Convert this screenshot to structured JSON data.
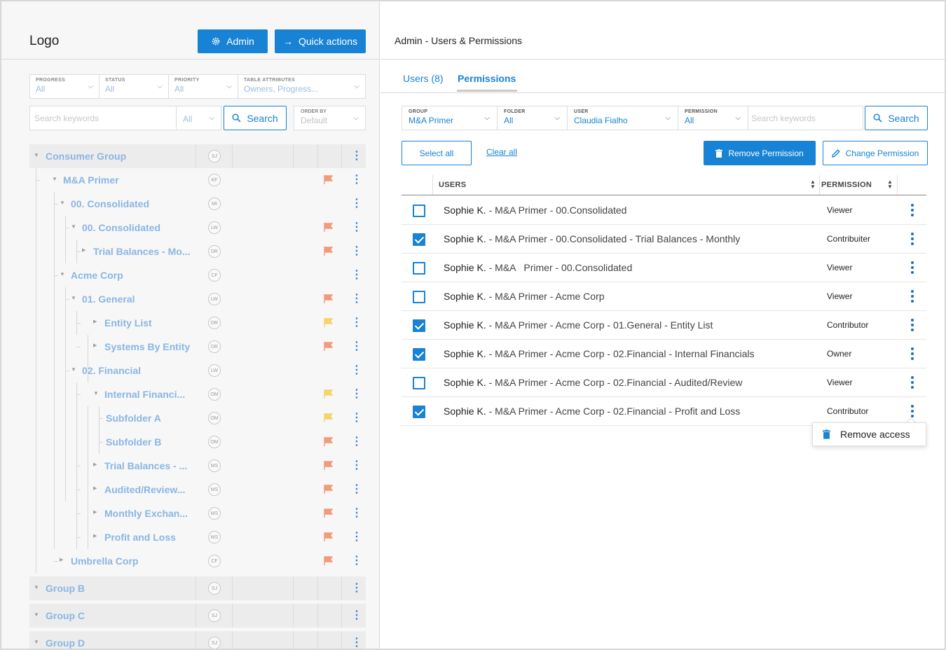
{
  "left": {
    "logo": "Logo",
    "admin_label": "Admin",
    "quick_actions_label": "Quick actions",
    "filters": [
      {
        "label": "PROGRESS",
        "value": "All"
      },
      {
        "label": "STATUS",
        "value": "All"
      },
      {
        "label": "PRIORITY",
        "value": "All"
      },
      {
        "label": "TABLE ATTRIBUTES",
        "value": "Owners, Progress..."
      }
    ],
    "search_placeholder": "Search keywords",
    "scope_value": "All",
    "search_label": "Search",
    "order_by": {
      "label": "ORDER BY",
      "value": "Default"
    },
    "tree": [
      {
        "name": "Consumer Group",
        "avatar": "SJ",
        "group": true,
        "flag": ""
      },
      {
        "name": "M&A Primer",
        "avatar": "KF",
        "flag": "#f19a7c"
      },
      {
        "name": "00. Consolidated",
        "avatar": "MI",
        "flag": ""
      },
      {
        "name": "00. Consolidated",
        "avatar": "LW",
        "flag": "#f19a7c"
      },
      {
        "name": "Trial Balances - Mo...",
        "avatar": "DR",
        "flag": "#f19a7c"
      },
      {
        "name": "Acme Corp",
        "avatar": "CF",
        "flag": ""
      },
      {
        "name": "01. General",
        "avatar": "LW",
        "flag": "#f19a7c"
      },
      {
        "name": "Entity List",
        "avatar": "DR",
        "flag": "#f6d46b"
      },
      {
        "name": "Systems By Entity",
        "avatar": "DR",
        "flag": "#f19a7c"
      },
      {
        "name": "02. Financial",
        "avatar": "LW",
        "flag": ""
      },
      {
        "name": "Internal Financi...",
        "avatar": "OM",
        "flag": "#f6d46b"
      },
      {
        "name": "Subfolder A",
        "avatar": "OM",
        "flag": "#f6d46b"
      },
      {
        "name": "Subfolder B",
        "avatar": "OM",
        "flag": "#f19a7c"
      },
      {
        "name": "Trial Balances - ...",
        "avatar": "MS",
        "flag": "#f19a7c"
      },
      {
        "name": "Audited/Review...",
        "avatar": "MS",
        "flag": "#f19a7c"
      },
      {
        "name": "Monthly Exchan...",
        "avatar": "MS",
        "flag": "#f19a7c"
      },
      {
        "name": "Profit and Loss",
        "avatar": "MS",
        "flag": "#f19a7c"
      },
      {
        "name": "Umbrella Corp",
        "avatar": "CF",
        "flag": "#f19a7c"
      },
      {
        "name": "Group B",
        "avatar": "SJ",
        "group": true,
        "flag": ""
      },
      {
        "name": "Group C",
        "avatar": "SJ",
        "group": true,
        "flag": ""
      },
      {
        "name": "Group D",
        "avatar": "SJ",
        "group": true,
        "flag": ""
      }
    ]
  },
  "right": {
    "title": "Admin - Users & Permissions",
    "tabs": [
      {
        "label": "Users (8)"
      },
      {
        "label": "Permissions"
      }
    ],
    "filters": [
      {
        "label": "GROUP",
        "value": "M&A Primer"
      },
      {
        "label": "FOLDER",
        "value": "All"
      },
      {
        "label": "USER",
        "value": "Claudia Fialho"
      },
      {
        "label": "PERMISSION",
        "value": "All"
      }
    ],
    "search_placeholder": "Search keywords",
    "search_label": "Search",
    "select_all_label": "Select all",
    "clear_all_label": "Clear all",
    "remove_permission_label": "Remove Permission",
    "change_permission_label": "Change Permission",
    "columns": {
      "users": "USERS",
      "permission": "PERMISSION"
    },
    "rows": [
      {
        "user": "Sophie K.",
        "path": " - M&A Primer - 00.Consolidated",
        "permission": "Viewer",
        "checked": false
      },
      {
        "user": "Sophie K.",
        "path": " - M&A Primer - 00.Consolidated - Trial Balances - Monthly",
        "permission": "Contribuiter",
        "checked": true
      },
      {
        "user": "Sophie K.",
        "path": " - M&A   Primer - 00.Consolidated",
        "permission": "Viewer",
        "checked": false
      },
      {
        "user": "Sophie K.",
        "path": " - M&A Primer - Acme Corp",
        "permission": "Viewer",
        "checked": false
      },
      {
        "user": "Sophie K.",
        "path": " - M&A Primer - Acme Corp - 01.General - Entity List",
        "permission": "Contributor",
        "checked": true
      },
      {
        "user": "Sophie K.",
        "path": " - M&A Primer - Acme Corp - 02.Financial - Internal Financials",
        "permission": "Owner",
        "checked": true
      },
      {
        "user": "Sophie K.",
        "path": " - M&A Primer - Acme Corp - 02.Financial - Audited/Review",
        "permission": "Viewer",
        "checked": false
      },
      {
        "user": "Sophie K.",
        "path": " - M&A Primer - Acme Corp - 02.Financial - Profit and Loss",
        "permission": "Contributor",
        "checked": true
      }
    ],
    "popup": {
      "label": "Remove access"
    }
  },
  "colors": {
    "accent": "#1883d4",
    "tree_text": "#8ab6e3",
    "flag_orange": "#f19a7c",
    "flag_yellow": "#f6d46b"
  }
}
